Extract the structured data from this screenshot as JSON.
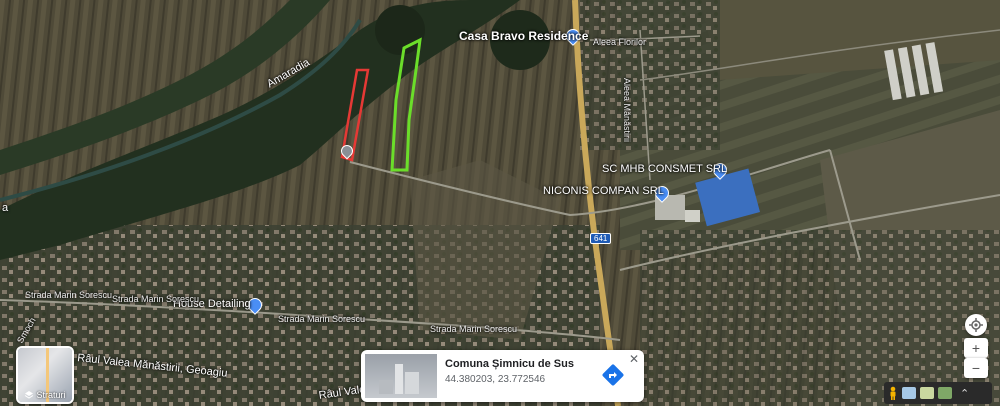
{
  "map_labels": {
    "casa_bravo": "Casa Bravo Residence",
    "aleea_florilor": "Aleea Florilor",
    "aleea_manastirii": "Aleea Mănăstirii",
    "amaradia": "Amaradia",
    "sc_mhb": "SC MHB CONSMET SRL",
    "niconis": "NICONIS COMPAN SRL",
    "house_detailing": "House Detailing",
    "strada_1": "Strada Marin Sorescu",
    "strada_2": "Strada Marin Sorescu",
    "strada_3": "Strada Marin Sorescu",
    "strada_4": "Strada Marin Sorescu",
    "raul_valea": "Râul Valea Mănăstirii, Geoagiu",
    "raul_valea_2": "Râul Valea",
    "route_641": "641",
    "left_edge_a": "a",
    "left_edge_smoch": "Smoch"
  },
  "layers_button": {
    "label": "Straturi",
    "icon": "layers-icon"
  },
  "info_card": {
    "title": "Comuna Șimnicu de Sus",
    "coords": "44.380203, 23.772546",
    "close_symbol": "✕"
  },
  "controls": {
    "zoom_in": "+",
    "zoom_out": "−",
    "locate_icon": "target-icon",
    "expand": "⌃"
  },
  "colors": {
    "plot_red": "#e53935",
    "plot_green": "#6bde2a",
    "marker_blue": "#4a8ef5",
    "route_badge": "#1f5bb5"
  }
}
